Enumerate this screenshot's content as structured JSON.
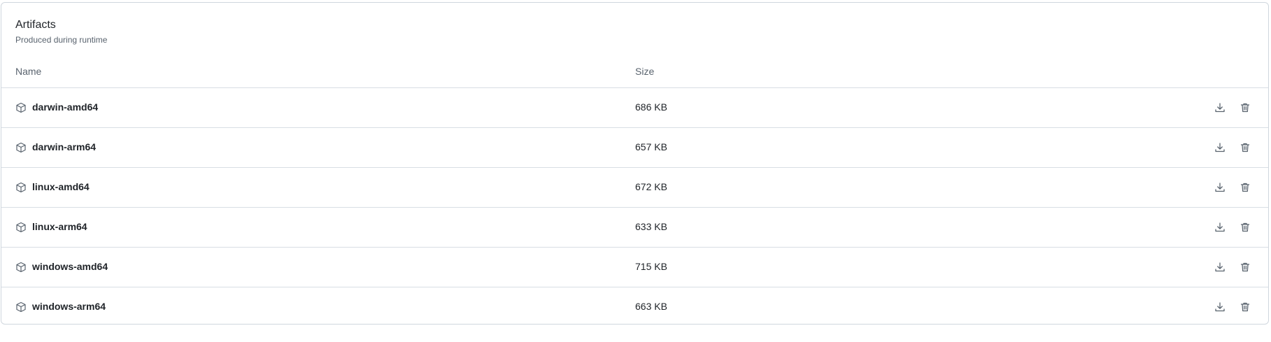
{
  "artifacts": {
    "title": "Artifacts",
    "subtitle": "Produced during runtime",
    "columns": {
      "name": "Name",
      "size": "Size"
    },
    "items": [
      {
        "name": "darwin-amd64",
        "size": "686 KB"
      },
      {
        "name": "darwin-arm64",
        "size": "657 KB"
      },
      {
        "name": "linux-amd64",
        "size": "672 KB"
      },
      {
        "name": "linux-arm64",
        "size": "633 KB"
      },
      {
        "name": "windows-amd64",
        "size": "715 KB"
      },
      {
        "name": "windows-arm64",
        "size": "663 KB"
      }
    ],
    "icons": {
      "item": "package-icon",
      "download": "download-icon",
      "delete": "trash-icon"
    }
  }
}
